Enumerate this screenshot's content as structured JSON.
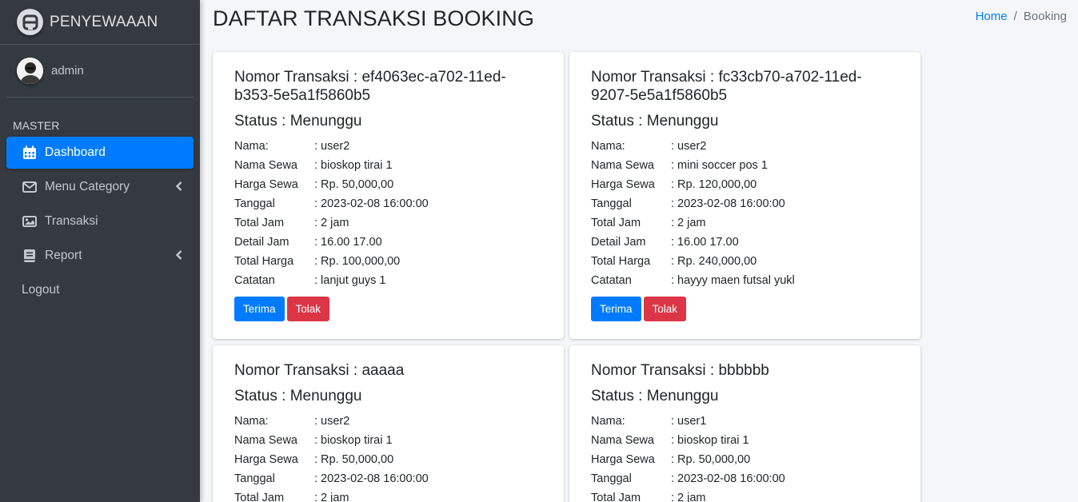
{
  "brand": {
    "name": "PENYEWAAAN",
    "icon": "logo-icon"
  },
  "user": {
    "name": "admin",
    "icon": "avatar"
  },
  "sidebar": {
    "header": "MASTER",
    "items": [
      {
        "label": "Dashboard",
        "icon": "calendar-icon",
        "active": true
      },
      {
        "label": "Menu Category",
        "icon": "envelope-icon",
        "has_children": true
      },
      {
        "label": "Transaksi",
        "icon": "image-icon"
      },
      {
        "label": "Report",
        "icon": "book-icon",
        "has_children": true
      },
      {
        "label": "Logout"
      }
    ]
  },
  "page": {
    "title": "DAFTAR TRANSAKSI BOOKING"
  },
  "breadcrumb": {
    "home": "Home",
    "separator": "/",
    "current": "Booking"
  },
  "labels": {
    "nomor": "Nomor Transaksi : ",
    "status": "Status : ",
    "nama": "Nama:",
    "nama_sewa": "Nama Sewa",
    "harga_sewa": "Harga Sewa",
    "tanggal": "Tanggal",
    "total_jam": "Total Jam",
    "detail_jam": "Detail Jam",
    "total_harga": "Total Harga",
    "catatan": "Catatan",
    "terima": "Terima",
    "tolak": "Tolak"
  },
  "transactions": [
    {
      "nomor": "ef4063ec-a702-11ed-b353-5e5a1f5860b5",
      "status": "Menunggu",
      "nama": ": user2",
      "nama_sewa": ": bioskop tirai 1",
      "harga_sewa": ": Rp. 50,000,00",
      "tanggal": ": 2023-02-08 16:00:00",
      "total_jam": ": 2 jam",
      "detail_jam": ": 16.00 17.00",
      "total_harga": ": Rp. 100,000,00",
      "catatan": ": lanjut guys 1"
    },
    {
      "nomor": "fc33cb70-a702-11ed-9207-5e5a1f5860b5",
      "status": "Menunggu",
      "nama": ": user2",
      "nama_sewa": ": mini soccer pos 1",
      "harga_sewa": ": Rp. 120,000,00",
      "tanggal": ": 2023-02-08 16:00:00",
      "total_jam": ": 2 jam",
      "detail_jam": ": 16.00 17.00",
      "total_harga": ": Rp. 240,000,00",
      "catatan": ": hayyy maen futsal yukl"
    },
    {
      "nomor": "aaaaa",
      "status": "Menunggu",
      "nama": ": user2",
      "nama_sewa": ": bioskop tirai 1",
      "harga_sewa": ": Rp. 50,000,00",
      "tanggal": ": 2023-02-08 16:00:00",
      "total_jam": ": 2 jam"
    },
    {
      "nomor": "bbbbbb",
      "status": "Menunggu",
      "nama": ": user1",
      "nama_sewa": ": bioskop tirai 1",
      "harga_sewa": ": Rp. 50,000,00",
      "tanggal": ": 2023-02-08 16:00:00",
      "total_jam": ": 2 jam"
    }
  ],
  "colors": {
    "sidebar_bg": "#343a40",
    "active_bg": "#007bff",
    "primary": "#007bff",
    "danger": "#dc3545",
    "content_bg": "#f4f6f9"
  }
}
